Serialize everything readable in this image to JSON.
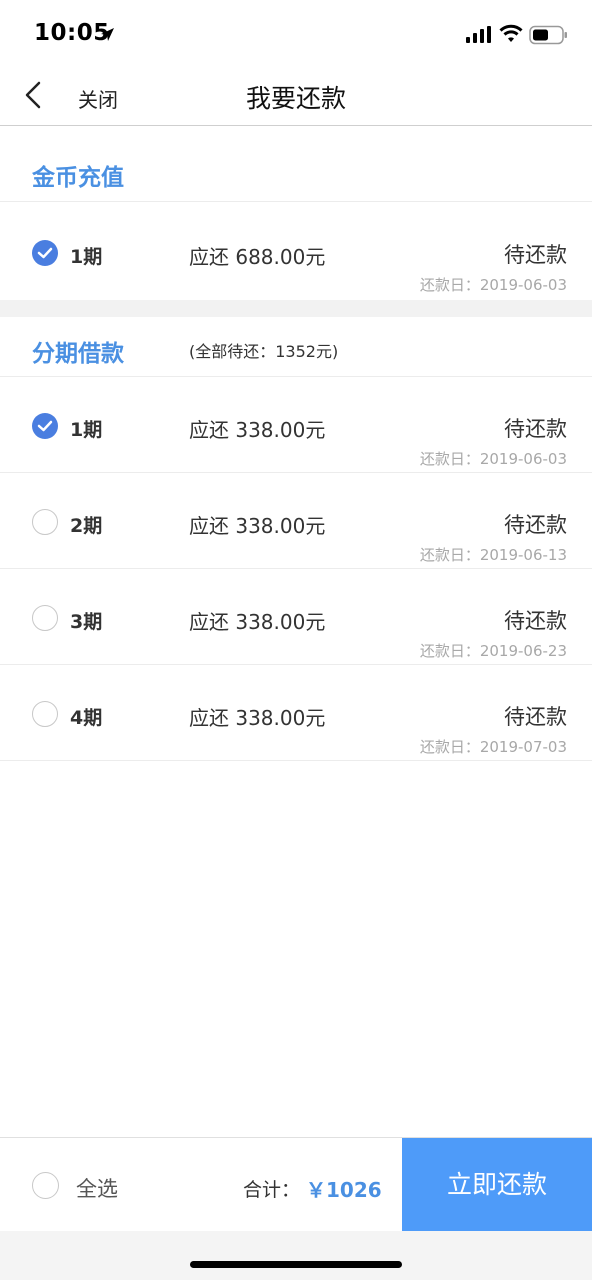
{
  "status_bar": {
    "time": "10:05"
  },
  "nav": {
    "close_label": "关闭",
    "title": "我要还款"
  },
  "gold": {
    "title": "金币充值",
    "items": [
      {
        "term": "1期",
        "amount": "应还 688.00元",
        "status": "待还款",
        "due": "还款日：2019-06-03",
        "checked": true
      }
    ]
  },
  "installment": {
    "title": "分期借款",
    "note": "(全部待还：1352元)",
    "items": [
      {
        "term": "1期",
        "amount": "应还 338.00元",
        "status": "待还款",
        "due": "还款日：2019-06-03",
        "checked": true
      },
      {
        "term": "2期",
        "amount": "应还 338.00元",
        "status": "待还款",
        "due": "还款日：2019-06-13",
        "checked": false
      },
      {
        "term": "3期",
        "amount": "应还 338.00元",
        "status": "待还款",
        "due": "还款日：2019-06-23",
        "checked": false
      },
      {
        "term": "4期",
        "amount": "应还 338.00元",
        "status": "待还款",
        "due": "还款日：2019-07-03",
        "checked": false
      }
    ]
  },
  "footer": {
    "select_all": "全选",
    "total_label": "合计：",
    "total_value": "￥1026",
    "pay_button": "立即还款"
  },
  "colors": {
    "accent": "#4a90e2",
    "button": "#4e9bf9",
    "check_on": "#4a7ee0"
  }
}
